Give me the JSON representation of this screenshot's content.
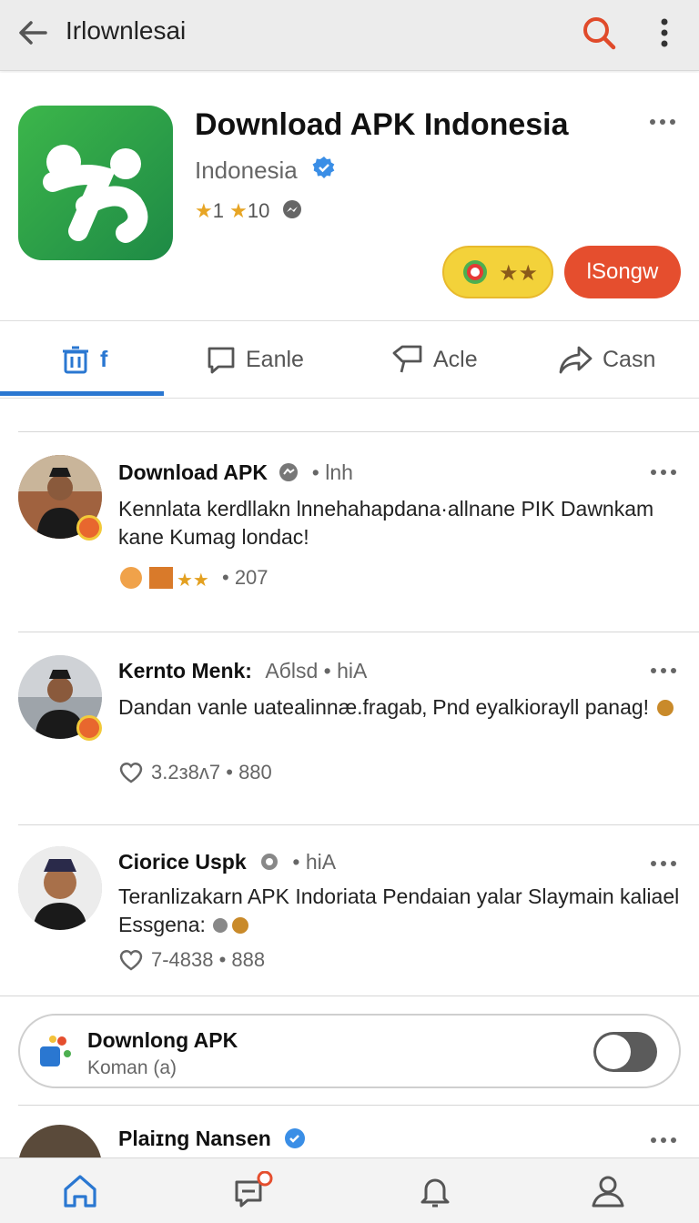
{
  "topbar": {
    "title": "Irlownlesai",
    "back_icon": "arrow-left-icon",
    "search_icon": "search-icon",
    "menu_icon": "kebab-menu-icon"
  },
  "colors": {
    "accent": "#2a77d1",
    "primary_red": "#e54e2e",
    "yellow": "#f3d23a",
    "app_green": "#2ea24a"
  },
  "app": {
    "title": "Download APK Indonesia",
    "subtitle": "Indonesia",
    "rating_a": "1",
    "rating_b": "10",
    "action_button": "lSongw"
  },
  "tabs": [
    {
      "label": "f",
      "icon": "trash-icon",
      "active": true
    },
    {
      "label": "Eanle",
      "icon": "comment-icon"
    },
    {
      "label": "Acle",
      "icon": "tag-icon"
    },
    {
      "label": "Casn",
      "icon": "share-icon"
    }
  ],
  "posts": [
    {
      "name": "Download APK",
      "meta": "• lnh",
      "body": "Kennlata  kerdllakn lnnehahapdana·allnane PIK Dawnkam kane Kumag londac!",
      "stats": "• 207"
    },
    {
      "name": "Kernto Menk:",
      "meta": "Aбlsd  •  hiA",
      "body": "Dandan vanle uatealinnæ.fragab‚ Pnd eyalkiorayll panag!",
      "stats": "3.2ᴈ8ᴧ7 • 880"
    },
    {
      "name": "Ciorice Uspk",
      "meta": "• hiA",
      "body": "Teranlizakarn APK Indoriata Pendaian yalar Slaymain kaliael Essgena:",
      "stats": "7-4838 • 888"
    }
  ],
  "promo": {
    "title": "Downlong APK",
    "subtitle": "Koman (a)",
    "toggle_on": false
  },
  "partial_post": {
    "name": "Plaiɪng Nansen"
  },
  "bottomnav": [
    {
      "icon": "home-icon",
      "active": true
    },
    {
      "icon": "chat-notification-icon"
    },
    {
      "icon": "bell-icon"
    },
    {
      "icon": "profile-icon"
    }
  ]
}
